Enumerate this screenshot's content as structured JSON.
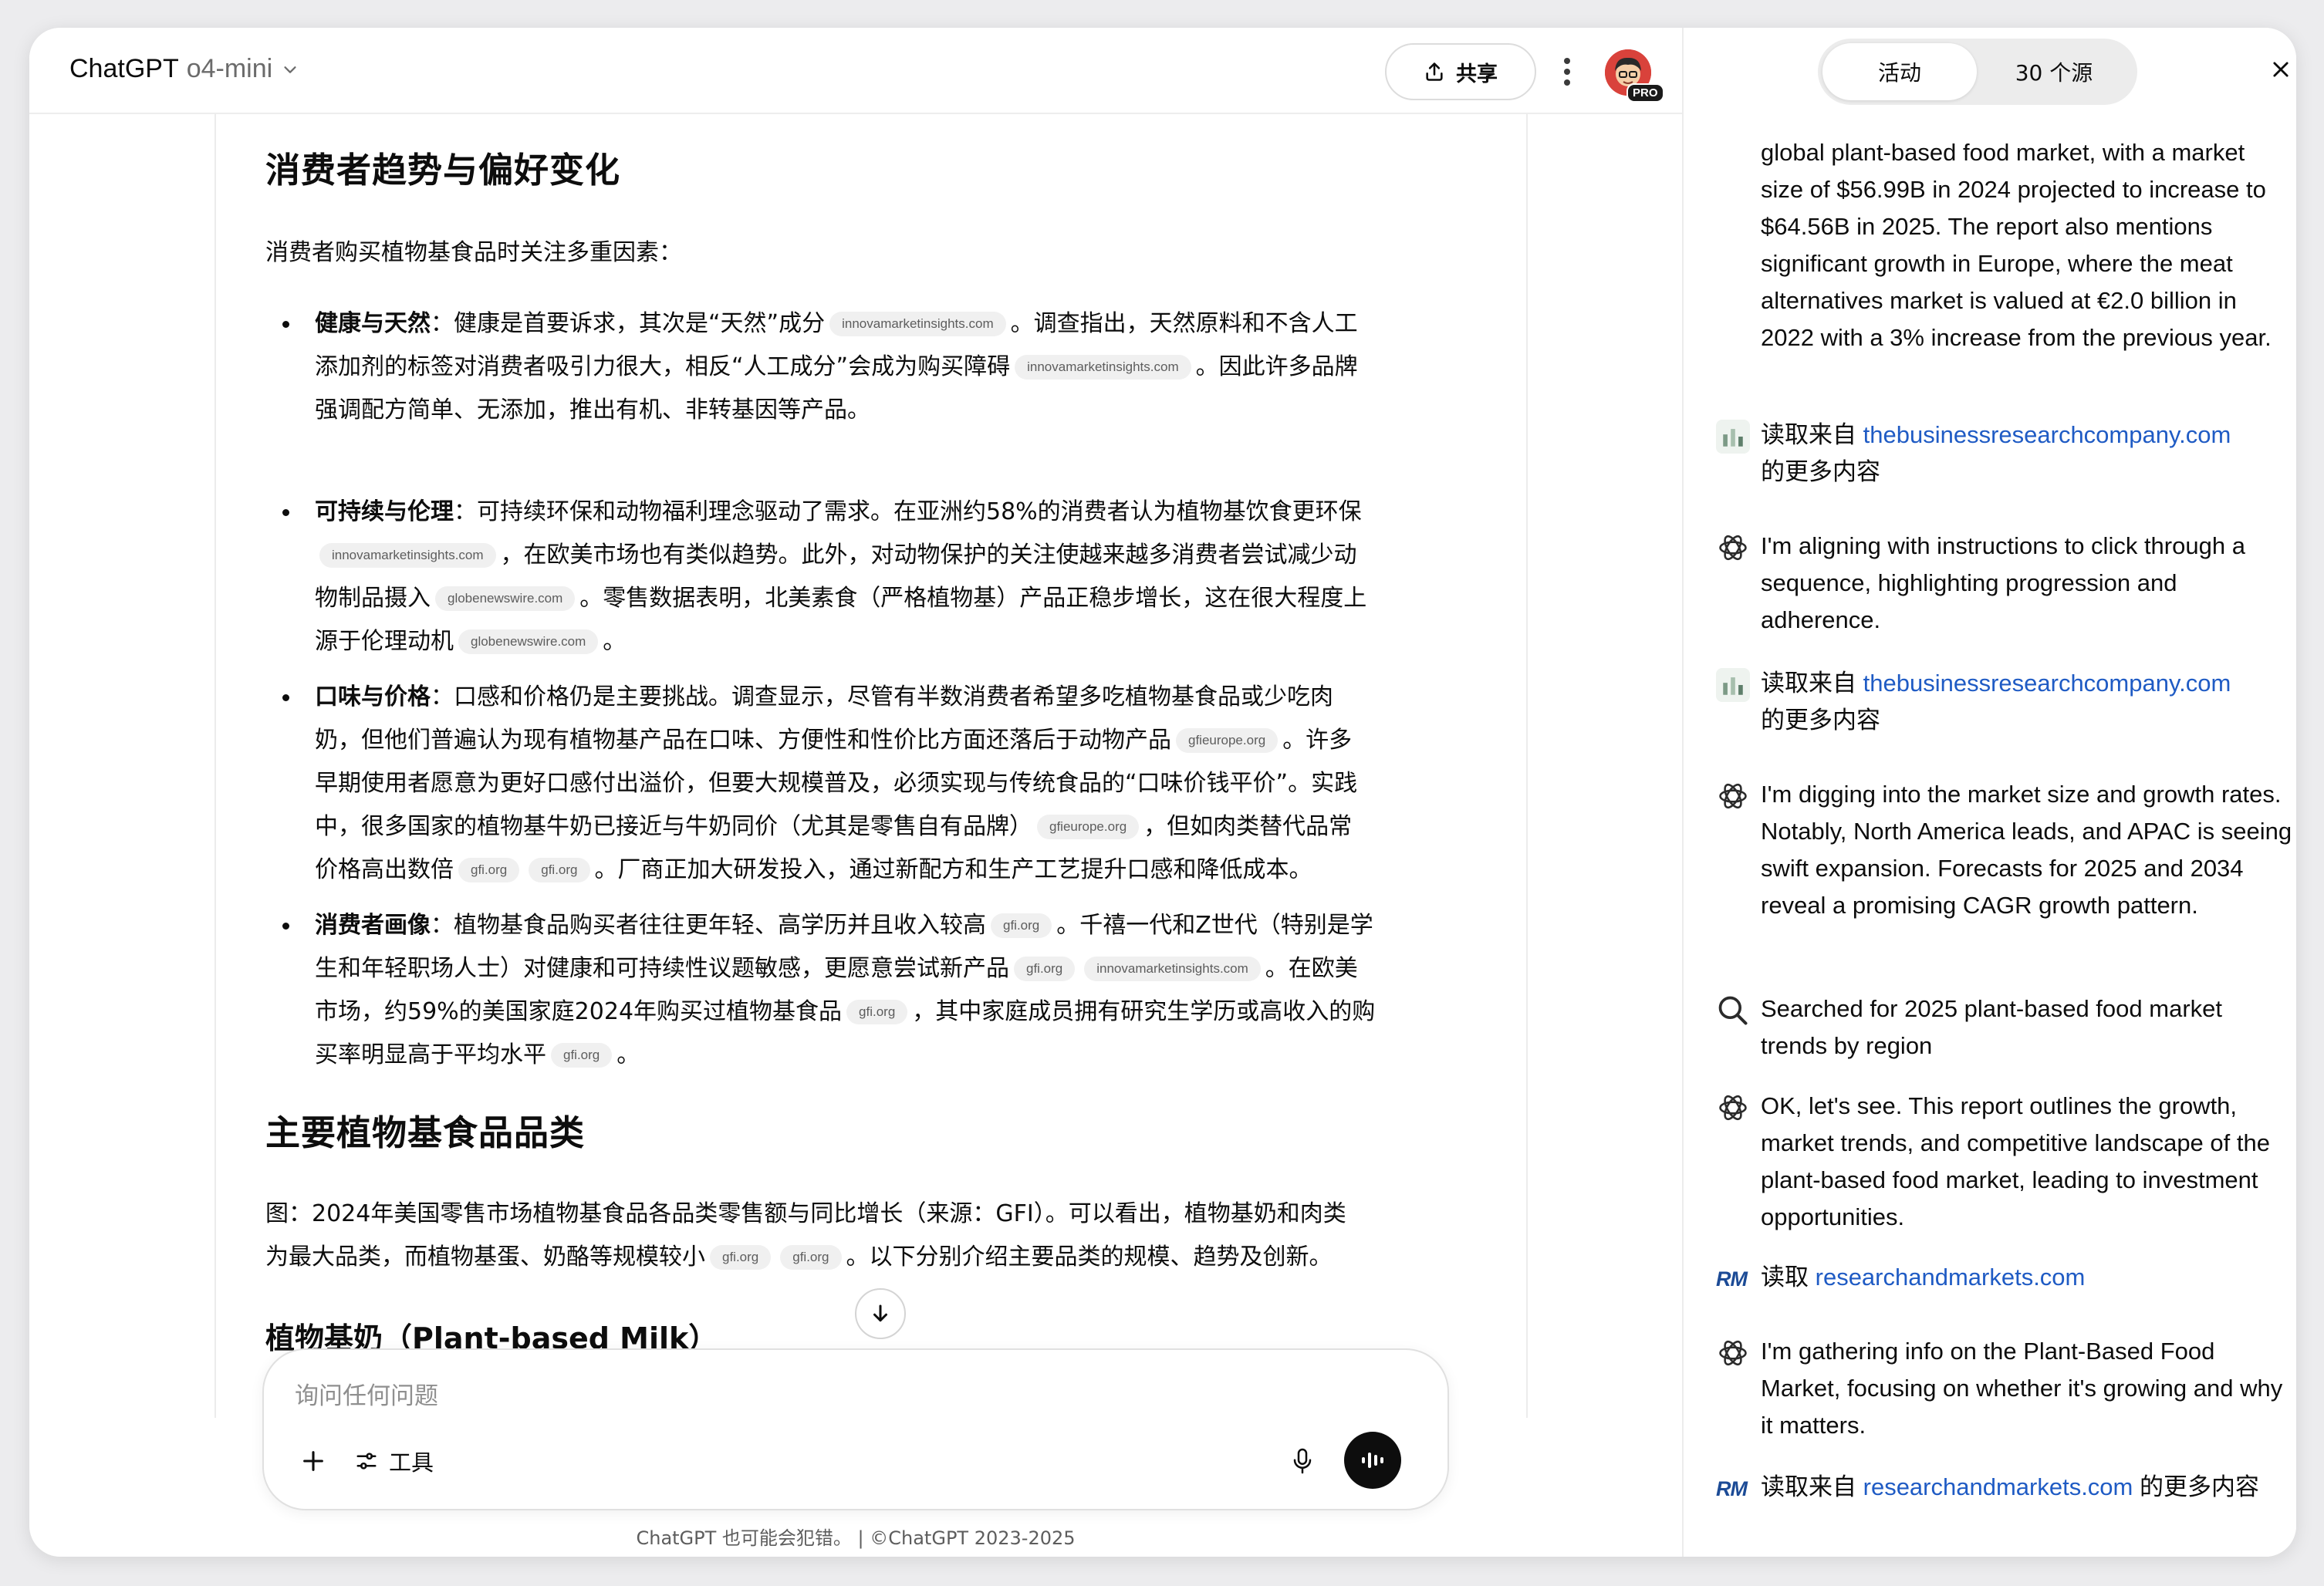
{
  "header": {
    "app_name": "ChatGPT",
    "model_name": "o4-mini",
    "share_label": "共享",
    "pro_badge": "PRO"
  },
  "content": {
    "section1_title": "消费者趋势与偏好变化",
    "section1_intro": "消费者购买植物基食品时关注多重因素：",
    "bullets": [
      {
        "title": "健康与天然",
        "lines": [
          {
            "t1": "：健康是首要诉求，其次是“天然”成分",
            "chip": "innovamarketinsights.com",
            "t2": "。调查指出，天然原料和不含人工"
          },
          {
            "t1": "添加剂的标签对消费者吸引力很大，相反“人工成分”会成为购买障碍",
            "chip": "innovamarketinsights.com",
            "t2": "。因此许多品牌"
          },
          {
            "t1": "强调配方简单、无添加，推出有机、非转基因等产品。"
          }
        ]
      },
      {
        "title": "可持续与伦理",
        "lines": [
          {
            "t1": "：可持续环保和动物福利理念驱动了需求。在亚洲约58%的消费者认为植物基饮食更环保"
          },
          {
            "chip": "innovamarketinsights.com",
            "t2": "，在欧美市场也有类似趋势。此外，对动物保护的关注使越来越多消费者尝试减少动"
          },
          {
            "t1": "物制品摄入",
            "chip": "globenewswire.com",
            "t2": "。零售数据表明，北美素食（严格植物基）产品正稳步增长，这在很大程度上"
          },
          {
            "t1": "源于伦理动机",
            "chip": "globenewswire.com",
            "t2": "。"
          }
        ]
      },
      {
        "title": "口味与价格",
        "lines": [
          {
            "t1": "：口感和价格仍是主要挑战。调查显示，尽管有半数消费者希望多吃植物基食品或少吃肉"
          },
          {
            "t1": "奶，但他们普遍认为现有植物基产品在口味、方便性和性价比方面还落后于动物产品",
            "chip": "gfieurope.org",
            "t2": "。许多"
          },
          {
            "t1": "早期使用者愿意为更好口感付出溢价，但要大规模普及，必须实现与传统食品的“口味价钱平价”。实践"
          },
          {
            "t1": "中，很多国家的植物基牛奶已接近与牛奶同价（尤其是零售自有品牌）",
            "chip": "gfieurope.org",
            "t2": "，但如肉类替代品常"
          },
          {
            "t1": "价格高出数倍",
            "chip": "gfi.org",
            "chip2": "gfi.org",
            "t2": "。厂商正加大研发投入，通过新配方和生产工艺提升口感和降低成本。"
          }
        ]
      },
      {
        "title": "消费者画像",
        "lines": [
          {
            "t1": "：植物基食品购买者往往更年轻、高学历并且收入较高",
            "chip": "gfi.org",
            "t2": "。千禧一代和Z世代（特别是学"
          },
          {
            "t1": "生和年轻职场人士）对健康和可持续性议题敏感，更愿意尝试新产品",
            "chip": "gfi.org",
            "chip2": "innovamarketinsights.com",
            "t2": "。在欧美"
          },
          {
            "t1": "市场，约59%的美国家庭2024年购买过植物基食品",
            "chip": "gfi.org",
            "t2": "，其中家庭成员拥有研究生学历或高收入的购"
          },
          {
            "t1": "买率明显高于平均水平",
            "chip": "gfi.org",
            "t2": "。"
          }
        ]
      }
    ],
    "section2_title": "主要植物基食品品类",
    "section2_line1": "图：2024年美国零售市场植物基食品各品类零售额与同比增长（来源：GFI）。可以看出，植物基奶和肉类",
    "section2_line2": "为最大品类，而植物基蛋、奶酪等规模较小",
    "section2_chip1": "gfi.org",
    "section2_chip2": "gfi.org",
    "section2_line2_end": "。以下分别介绍主要品类的规模、趋势及创新。",
    "subsection_title": "植物基奶（Plant-based Milk）"
  },
  "composer": {
    "placeholder": "询问任何问题",
    "tools_label": "工具"
  },
  "footer": {
    "disclaimer": "ChatGPT 也可能会犯错。 | ©ChatGPT 2023-2025"
  },
  "panel": {
    "tab_activity": "活动",
    "tab_sources": "30 个源",
    "items": [
      {
        "icon": "none",
        "text": "global plant-based food market, with a market size of $56.99B in 2024 projected to increase to $64.56B in 2025. The report also mentions significant growth in Europe, where the meat alternatives market is valued at €2.0 billion in 2022 with a 3% increase from the previous year."
      },
      {
        "icon": "site-favicon",
        "prefix": "读取来自 ",
        "link": "thebusinessresearchcompany.com",
        "suffix": "的更多内容"
      },
      {
        "icon": "openai-icon",
        "text": "I'm aligning with instructions to click through a sequence, highlighting progression and adherence."
      },
      {
        "icon": "site-favicon",
        "prefix": "读取来自 ",
        "link": "thebusinessresearchcompany.com",
        "suffix": "的更多内容"
      },
      {
        "icon": "openai-icon",
        "text": "I'm digging into the market size and growth rates. Notably, North America leads, and APAC is seeing swift expansion. Forecasts for 2025 and 2034 reveal a promising CAGR growth pattern."
      },
      {
        "icon": "search-icon",
        "text": "Searched for 2025 plant-based food market trends by region"
      },
      {
        "icon": "openai-icon",
        "text": "OK, let's see. This report outlines the growth, market trends, and competitive landscape of the plant-based food market, leading to investment opportunities."
      },
      {
        "icon": "rm-favicon",
        "prefix": "读取 ",
        "link": "researchandmarkets.com",
        "suffix": ""
      },
      {
        "icon": "openai-icon",
        "text": "I'm gathering info on the Plant-Based Food Market, focusing on whether it's growing and why it matters."
      },
      {
        "icon": "rm-favicon",
        "prefix": "读取来自 ",
        "link": "researchandmarkets.com",
        "suffix": " 的更多内容"
      }
    ],
    "rm_label": "RM"
  },
  "colors": {
    "link": "#1f5bc4",
    "chip_bg": "#f0f0f0",
    "avatar_bg": "#d9423b"
  }
}
